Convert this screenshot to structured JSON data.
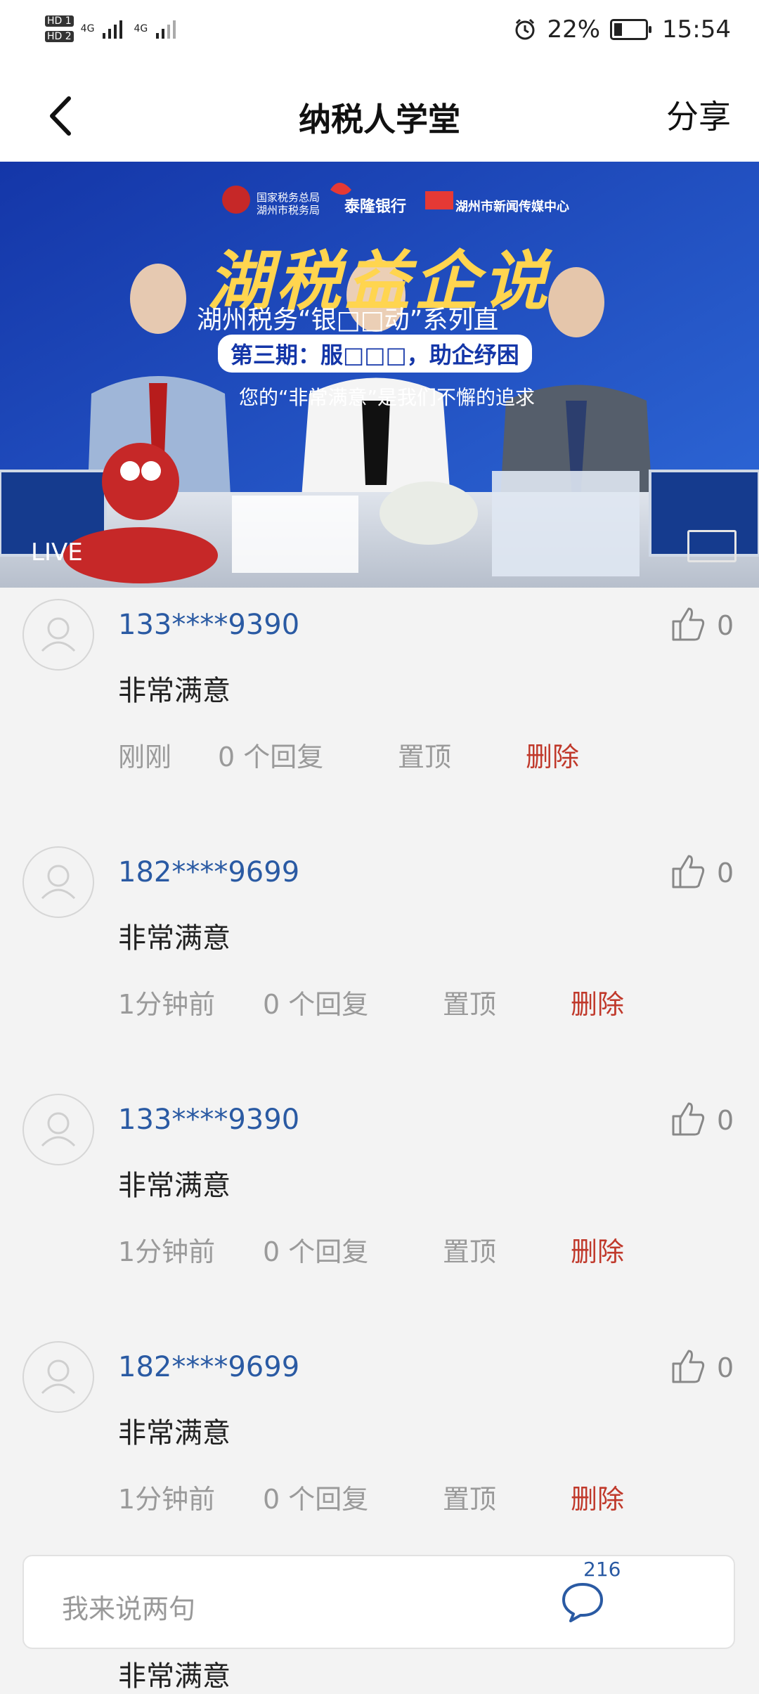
{
  "status_bar": {
    "hd1": "HD 1",
    "hd2": "HD 2",
    "net1": "4G",
    "net2": "4G",
    "battery": "22%",
    "time": "15:54"
  },
  "header": {
    "title": "纳税人学堂",
    "share_label": "分享"
  },
  "video": {
    "live_label": "LIVE",
    "logos": [
      "国家税务总局 湖州市税务局",
      "泰隆银行",
      "湖州市新闻传媒中心"
    ],
    "headline": "湖税益企说",
    "subheadline": "湖州税务“银□□动”系列直",
    "episode": "第三期：服□□□，助企纾困",
    "tagline": "您的“非常满意”是我们不懈的追求"
  },
  "comments": [
    {
      "user": "133****9390",
      "likes": "0",
      "text": "非常满意",
      "time": "刚刚",
      "replies": "0 个回复",
      "pin": "置顶",
      "delete": "删除"
    },
    {
      "user": "182****9699",
      "likes": "0",
      "text": "非常满意",
      "time": "1分钟前",
      "replies": "0 个回复",
      "pin": "置顶",
      "delete": "删除"
    },
    {
      "user": "133****9390",
      "likes": "0",
      "text": "非常满意",
      "time": "1分钟前",
      "replies": "0 个回复",
      "pin": "置顶",
      "delete": "删除"
    },
    {
      "user": "182****9699",
      "likes": "0",
      "text": "非常满意",
      "time": "1分钟前",
      "replies": "0 个回复",
      "pin": "置顶",
      "delete": "删除"
    }
  ],
  "peek_comment_text": "非常满意",
  "input": {
    "placeholder": "我来说两句",
    "comment_count": "216"
  },
  "colors": {
    "username": "#2a5aa3",
    "delete": "#c0392b",
    "meta": "#9a9a9a",
    "video_bg": "#1a3d9e"
  }
}
